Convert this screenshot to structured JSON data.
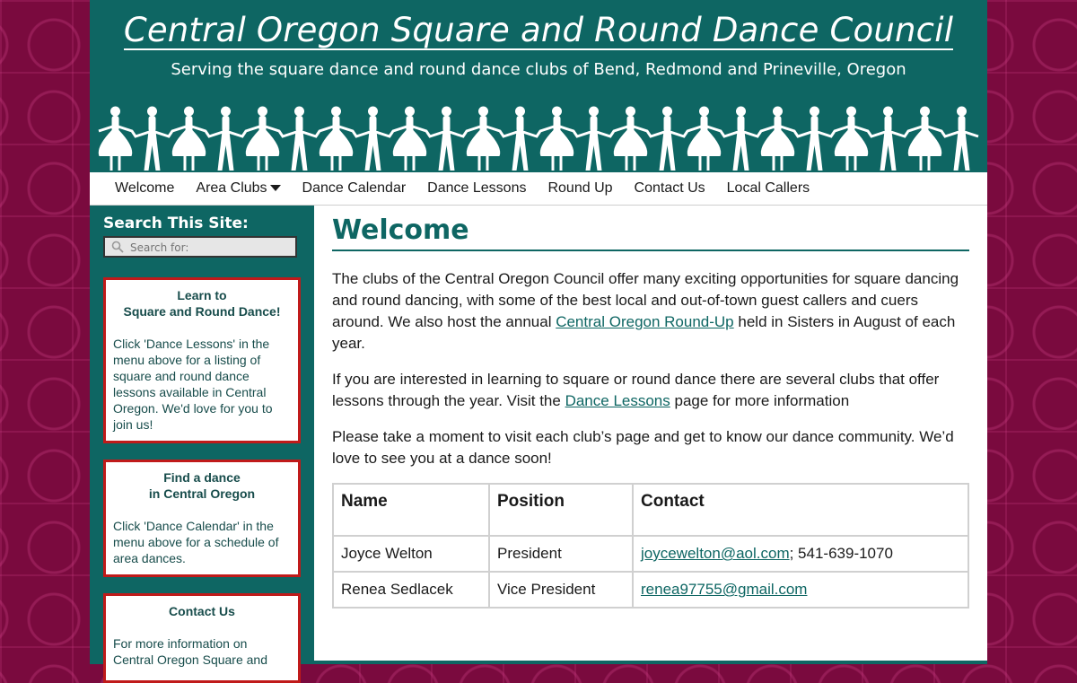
{
  "header": {
    "title": "Central Oregon Square and Round Dance Council",
    "tagline": "Serving the square dance and round dance clubs of Bend, Redmond and Prineville, Oregon",
    "banner_image": "dancing-couples-silhouette"
  },
  "nav": {
    "items": [
      {
        "label": "Welcome"
      },
      {
        "label": "Area Clubs",
        "has_dropdown": true
      },
      {
        "label": "Dance Calendar"
      },
      {
        "label": "Dance Lessons"
      },
      {
        "label": "Round Up"
      },
      {
        "label": "Contact Us"
      },
      {
        "label": "Local Callers"
      }
    ]
  },
  "sidebar": {
    "search_heading": "Search This Site:",
    "search_placeholder": "Search for:",
    "widgets": [
      {
        "title_line1": "Learn to",
        "title_line2": "Square and Round Dance!",
        "body": "Click 'Dance Lessons' in the menu above for a listing of square and round dance lessons available in Central Oregon. We'd love for you to join us!"
      },
      {
        "title_line1": "Find a dance",
        "title_line2": "in Central Oregon",
        "body": "Click 'Dance Calendar' in the menu above for a schedule of area dances."
      },
      {
        "title_line1": "Contact Us",
        "title_line2": "",
        "body": "For more information on Central Oregon Square and"
      }
    ]
  },
  "main": {
    "title": "Welcome",
    "p1_before": "The clubs of the Central Oregon Council offer many exciting opportunities for square dancing and round dancing, with some of the best local and out-of-town guest callers and cuers around.  We also host the annual ",
    "p1_link": "Central Oregon Round-Up",
    "p1_after": " held in Sisters in August of each year.",
    "p2_before": "If you are interested in learning to square or round dance there are several clubs that offer lessons through the year.  Visit the ",
    "p2_link": "Dance Lessons",
    "p2_after": " page for more information",
    "p3": "Please take a moment to visit each club’s page and get to know our dance community.  We’d love to see you at a dance soon!",
    "table": {
      "headers": [
        "Name",
        "Position",
        "Contact"
      ],
      "rows": [
        {
          "name": "Joyce Welton",
          "position": "President",
          "email": "joycewelton@aol.com",
          "phone": "; 541-639-1070"
        },
        {
          "name": "Renea Sedlacek",
          "position": "Vice President",
          "email": "renea97755@gmail.com",
          "phone": ""
        }
      ]
    }
  },
  "colors": {
    "teal": "#0e6663",
    "maroon": "#7a0a3e",
    "widget_border": "#c01a1a"
  }
}
